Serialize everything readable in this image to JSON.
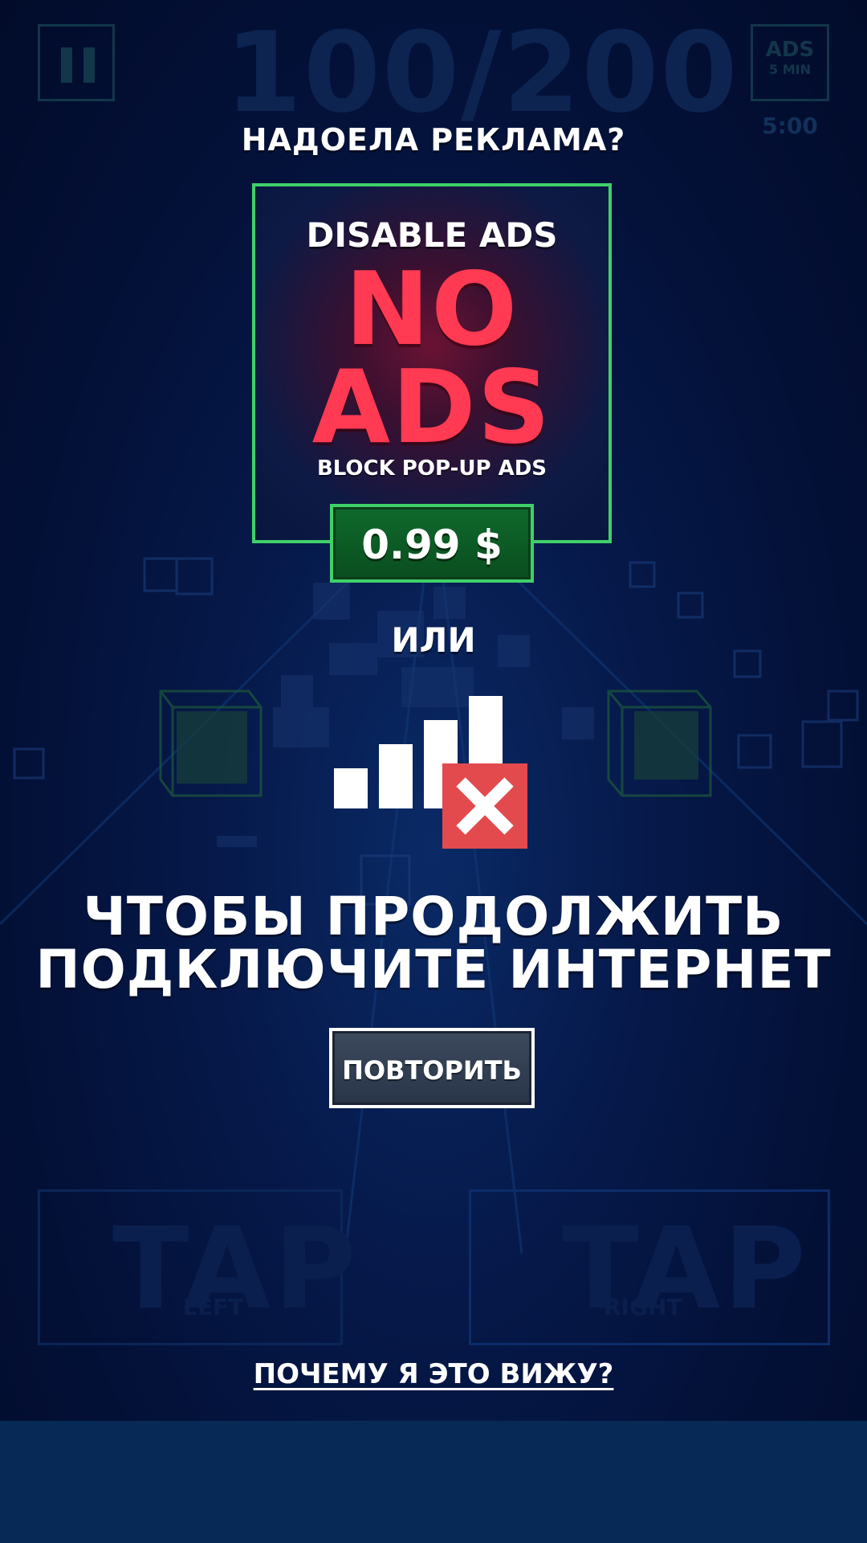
{
  "colors": {
    "background": "#020d2e",
    "accent_green": "#3fd06a",
    "no_ads_red": "#ff3a52",
    "no_signal_red": "#e24a4e",
    "retry_button": "#2f3b4f"
  },
  "background_scene": {
    "score": "100/200",
    "ads_badge": {
      "label": "ADS",
      "sublabel": "5 MIN"
    },
    "timer": "5:00",
    "tap_left": {
      "label": "TAP",
      "sublabel": "LEFT"
    },
    "tap_right": {
      "label": "TAP",
      "sublabel": "RIGHT"
    },
    "icons": [
      "pause-icon"
    ]
  },
  "offer": {
    "question": "НАДОЕЛА РЕКЛАМА?",
    "card_title": "DISABLE ADS",
    "big_line1": "NO",
    "big_line2": "ADS",
    "subtitle": "BLOCK POP-UP ADS",
    "price": "0.99 $"
  },
  "or_label": "ИЛИ",
  "connection": {
    "icon": "no-signal-icon",
    "message_line1": "ЧТОБЫ ПРОДОЛЖИТЬ",
    "message_line2": "ПОДКЛЮЧИТЕ ИНТЕРНЕТ",
    "retry_label": "ПОВТОРИТЬ"
  },
  "why_link": "ПОЧЕМУ Я ЭТО ВИЖУ?"
}
